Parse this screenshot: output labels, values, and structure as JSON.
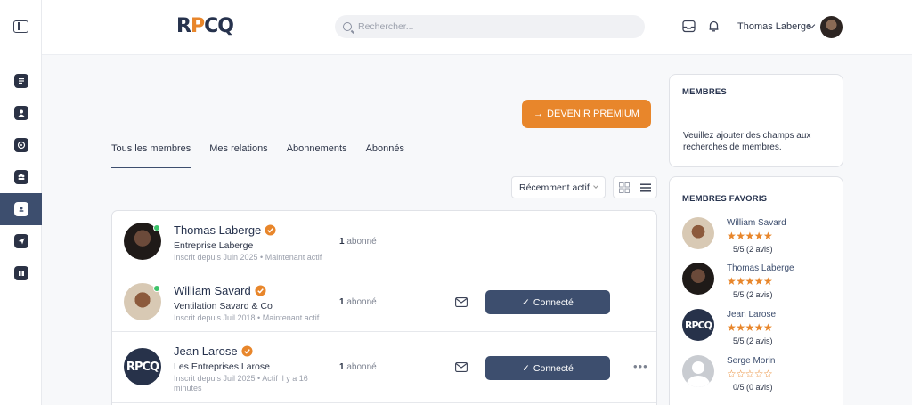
{
  "header": {
    "logo": {
      "part1": "R",
      "part2": "P",
      "part3": "CQ"
    },
    "search_placeholder": "Rechercher...",
    "user_name": "Thomas Laberge"
  },
  "main": {
    "premium_button": "DEVENIR PREMIUM",
    "tabs": [
      {
        "label": "Tous les membres",
        "active": true
      },
      {
        "label": "Mes relations",
        "active": false
      },
      {
        "label": "Abonnements",
        "active": false
      },
      {
        "label": "Abonnés",
        "active": false
      }
    ],
    "sort_value": "Récemment actif",
    "members": [
      {
        "name": "Thomas Laberge",
        "company": "Entreprise Laberge",
        "meta": "Inscrit depuis Juin 2025  •  Maintenant actif",
        "followers_count": "1",
        "followers_label": " abonné"
      },
      {
        "name": "William Savard",
        "company": "Ventilation Savard & Co",
        "meta": "Inscrit depuis Juil 2018  •  Maintenant actif",
        "followers_count": "1",
        "followers_label": " abonné",
        "connect_label": "Connecté"
      },
      {
        "name": "Jean Larose",
        "company": "Les Entreprises Larose",
        "meta": "Inscrit depuis Juil 2025  •  Actif Il y a 16 minutes",
        "followers_count": "1",
        "followers_label": " abonné",
        "connect_label": "Connecté"
      }
    ]
  },
  "panels": {
    "members": {
      "title": "MEMBRES",
      "text": "Veuillez ajouter des champs aux recherches de membres."
    },
    "favorites": {
      "title": "MEMBRES FAVORIS",
      "items": [
        {
          "name": "William Savard",
          "stars": "★★★★★",
          "rating": "5/5 (2 avis)"
        },
        {
          "name": "Thomas Laberge",
          "stars": "★★★★★",
          "rating": "5/5 (2 avis)"
        },
        {
          "name": "Jean Larose",
          "stars": "★★★★★",
          "rating": "5/5 (2 avis)"
        },
        {
          "name": "Serge Morin",
          "stars": "☆☆☆☆☆",
          "rating": "0/5 (0 avis)"
        }
      ]
    }
  },
  "colors": {
    "accent": "#e8862b",
    "primary": "#3d4e6e",
    "online": "#3ec36b"
  }
}
